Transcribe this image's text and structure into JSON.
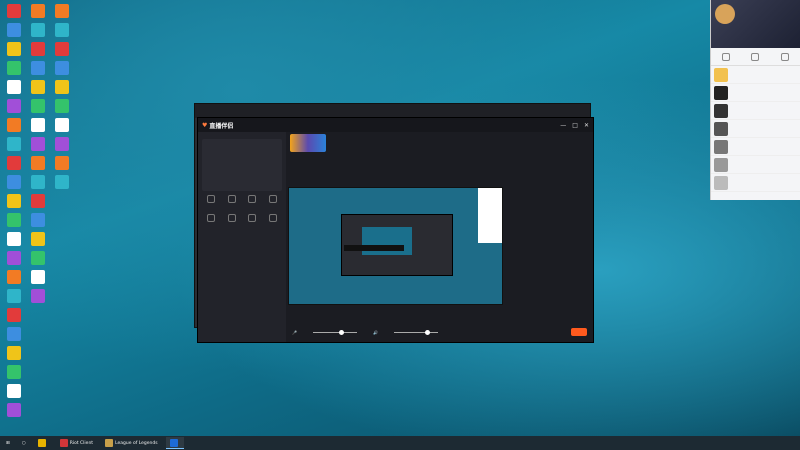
{
  "desktop": {
    "icons": []
  },
  "back_window": {
    "tabs": [
      "",
      "",
      ""
    ]
  },
  "app": {
    "title": "直播伴侣",
    "version": "",
    "sidebar": {
      "section1_title": "",
      "section2_title": "",
      "section3_title": "",
      "add_label": "",
      "tools": [
        "",
        "",
        "",
        "",
        "",
        "",
        "",
        ""
      ]
    },
    "header": {
      "stream_title": "",
      "tag": ""
    },
    "banner_text": "",
    "controls": {
      "mic_label": "",
      "mic_value": "",
      "speaker_label": "",
      "speaker_value": "",
      "start_button": ""
    },
    "right_panel": {
      "text": "",
      "button1": "",
      "button2": ""
    },
    "window_controls": [
      "—",
      "□",
      "✕"
    ]
  },
  "qq": {
    "username": "",
    "items": [
      {
        "title": ""
      },
      {
        "title": ""
      },
      {
        "title": ""
      },
      {
        "title": ""
      },
      {
        "title": ""
      },
      {
        "title": ""
      },
      {
        "title": ""
      }
    ]
  },
  "taskbar": {
    "items": [
      {
        "label": "",
        "color": "#e8b400"
      },
      {
        "label": "Riot Client",
        "color": "#d13639"
      },
      {
        "label": "League of Legends",
        "color": "#c8a04a"
      },
      {
        "label": "",
        "color": "#1e6bd6"
      }
    ],
    "time": "",
    "date": ""
  },
  "colors": {
    "accent": "#ff5a1e",
    "desktop": "#1689a6"
  }
}
